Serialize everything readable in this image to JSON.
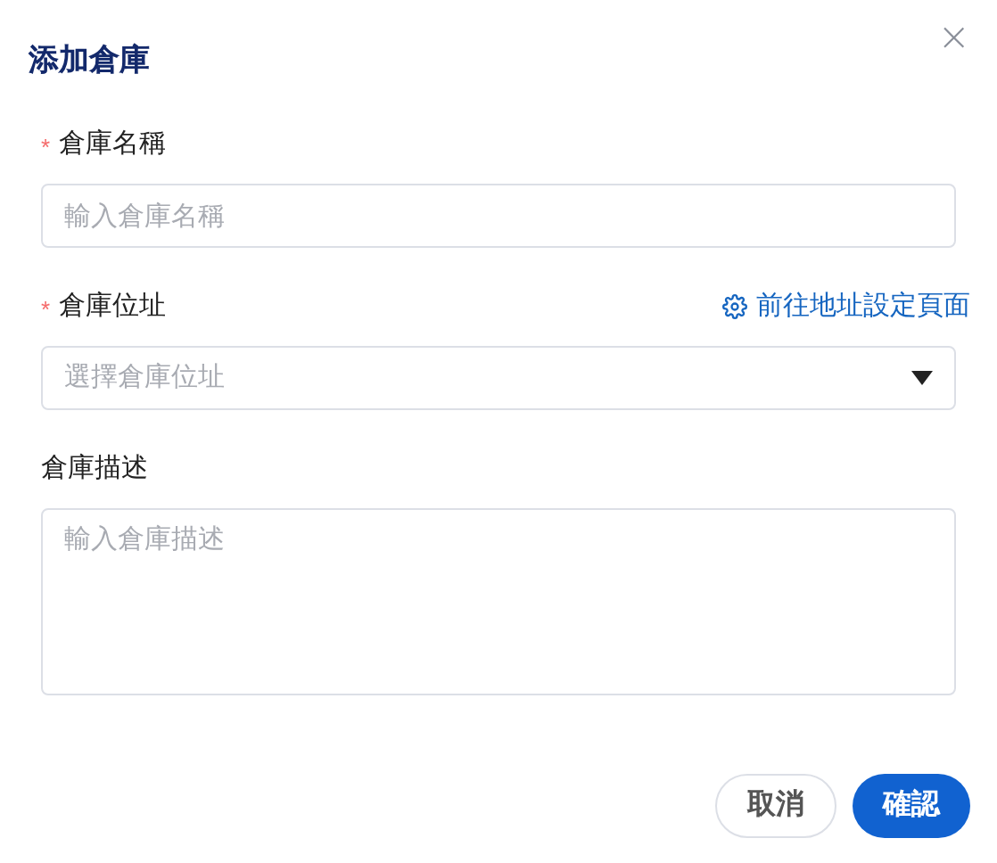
{
  "dialog": {
    "title": "添加倉庫",
    "close": "×"
  },
  "fields": [
    {
      "kind": "text",
      "required_mark": "*",
      "label": "倉庫名稱",
      "placeholder": "輸入倉庫名稱"
    },
    {
      "kind": "select",
      "required_mark": "*",
      "label": "倉庫位址",
      "placeholder": "選擇倉庫位址",
      "link": "前往地址設定頁面"
    },
    {
      "kind": "textarea",
      "label": "倉庫描述",
      "placeholder": "輸入倉庫描述"
    }
  ],
  "buttons": [
    {
      "label": "取消",
      "primary": false
    },
    {
      "label": "確認",
      "primary": true
    }
  ]
}
